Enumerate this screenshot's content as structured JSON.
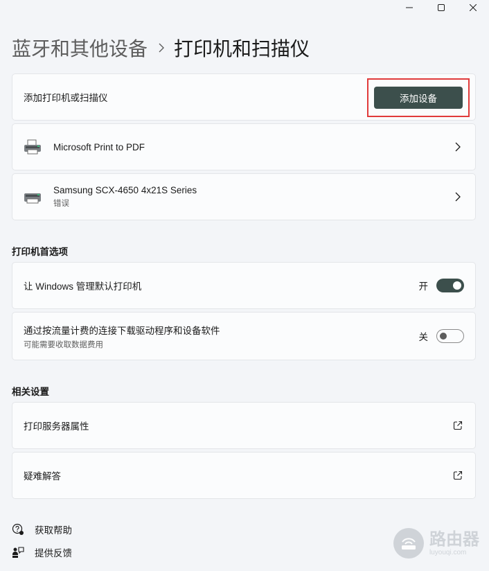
{
  "window_controls": {
    "minimize": "minimize",
    "maximize": "maximize",
    "close": "close"
  },
  "breadcrumb": {
    "parent": "蓝牙和其他设备",
    "current": "打印机和扫描仪"
  },
  "add_card": {
    "label": "添加打印机或扫描仪",
    "button": "添加设备"
  },
  "printers": [
    {
      "name": "Microsoft Print to PDF",
      "status": ""
    },
    {
      "name": "Samsung SCX-4650 4x21S Series",
      "status": "错误"
    }
  ],
  "preferences": {
    "title": "打印机首选项",
    "items": [
      {
        "label": "让 Windows 管理默认打印机",
        "desc": "",
        "state_label": "开",
        "on": true
      },
      {
        "label": "通过按流量计费的连接下载驱动程序和设备软件",
        "desc": "可能需要收取数据费用",
        "state_label": "关",
        "on": false
      }
    ]
  },
  "related": {
    "title": "相关设置",
    "items": [
      {
        "label": "打印服务器属性"
      },
      {
        "label": "疑难解答"
      }
    ]
  },
  "footer": {
    "help": "获取帮助",
    "feedback": "提供反馈"
  },
  "watermark": {
    "title": "路由器",
    "url": "luyouqi.com"
  },
  "colors": {
    "accent": "#3c4f4c",
    "highlight_border": "#e03a3a",
    "background": "#f3f5f8",
    "card": "#fbfcfd"
  }
}
